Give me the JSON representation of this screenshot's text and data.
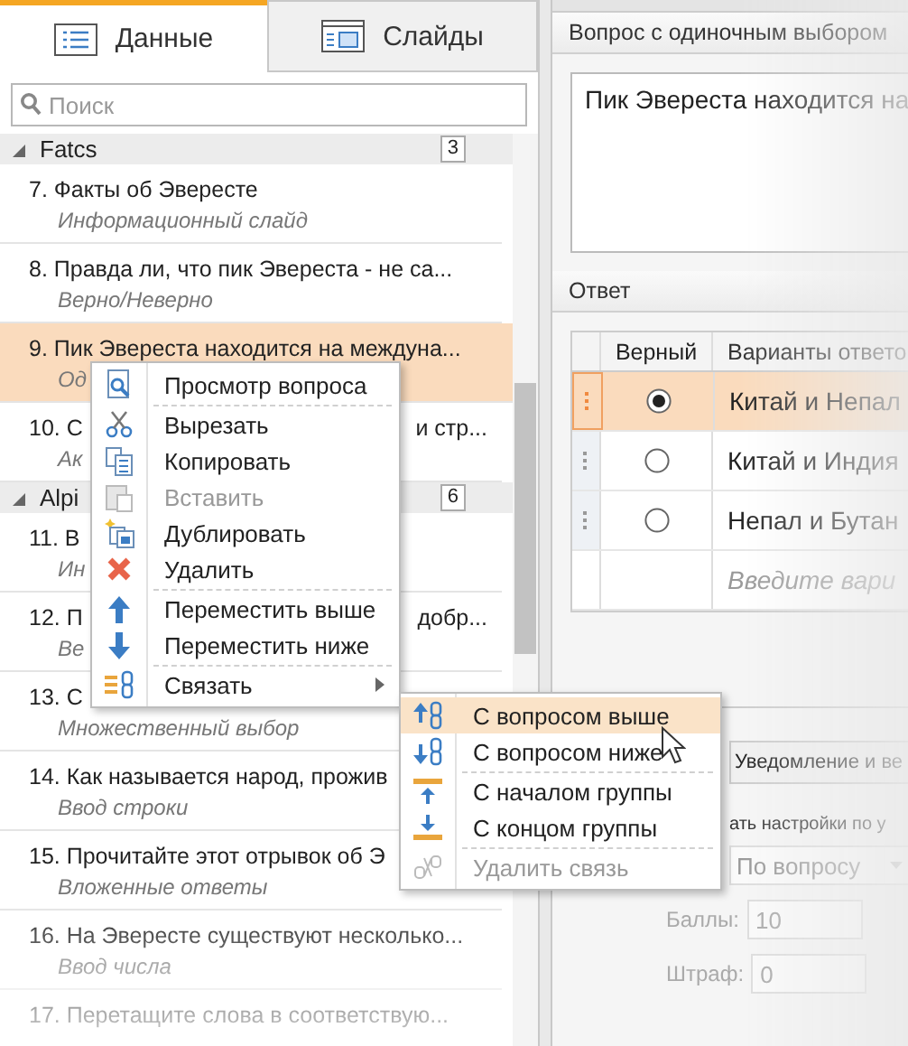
{
  "tabs": [
    {
      "label": "Данные",
      "selected": true
    },
    {
      "label": "Слайды",
      "selected": false
    }
  ],
  "search": {
    "placeholder": "Поиск"
  },
  "groups": [
    {
      "name": "Fatcs",
      "count": "3",
      "expanded": true,
      "items": [
        {
          "title": "7. Факты об Эвересте",
          "subtitle": "Информационный слайд",
          "selected": false
        },
        {
          "title": "8. Правда ли, что пик Эвереста - не са...",
          "subtitle": "Верно/Неверно",
          "selected": false
        },
        {
          "title": "9. Пик Эвереста находится на междуна...",
          "subtitle": "Од",
          "selected": true
        },
        {
          "title": "10. С",
          "title_end": "и стр...",
          "subtitle": "Ак",
          "selected": false
        }
      ]
    },
    {
      "name": "Alpi",
      "count": "6",
      "expanded": true,
      "items": [
        {
          "title": "11. В",
          "subtitle": "Ин",
          "selected": false
        },
        {
          "title": "12. П",
          "title_end": "добр...",
          "subtitle": "Ве",
          "selected": false
        },
        {
          "title": "13. С",
          "subtitle": "Множественный выбор",
          "selected": false
        },
        {
          "title": "14. Как называется народ, прожив",
          "subtitle": "Ввод строки",
          "selected": false
        },
        {
          "title": "15. Прочитайте этот отрывок об Э",
          "subtitle": "Вложенные ответы",
          "selected": false
        },
        {
          "title": "16. На Эвересте существуют несколько...",
          "subtitle": "Ввод числа",
          "selected": false
        },
        {
          "title": "17. Перетащите слова в соответствую...",
          "selected": false
        }
      ]
    }
  ],
  "context_menu": {
    "items": [
      {
        "kind": "item",
        "label": "Просмотр вопроса",
        "disabled": false
      },
      {
        "kind": "separator"
      },
      {
        "kind": "item",
        "label": "Вырезать",
        "disabled": false
      },
      {
        "kind": "item",
        "label": "Копировать",
        "disabled": false
      },
      {
        "kind": "item",
        "label": "Вставить",
        "disabled": true
      },
      {
        "kind": "item",
        "label": "Дублировать",
        "disabled": false
      },
      {
        "kind": "item",
        "label": "Удалить",
        "disabled": false
      },
      {
        "kind": "separator"
      },
      {
        "kind": "item",
        "label": "Переместить выше",
        "disabled": false
      },
      {
        "kind": "item",
        "label": "Переместить ниже",
        "disabled": false
      },
      {
        "kind": "separator"
      },
      {
        "kind": "item",
        "label": "Связать",
        "disabled": false,
        "has_submenu": true
      }
    ]
  },
  "submenu": {
    "items": [
      {
        "kind": "item",
        "label": "С вопросом выше",
        "selected": true,
        "disabled": false
      },
      {
        "kind": "item",
        "label": "С вопросом ниже",
        "selected": false,
        "disabled": false
      },
      {
        "kind": "separator"
      },
      {
        "kind": "item",
        "label": "С началом группы",
        "selected": false,
        "disabled": false
      },
      {
        "kind": "item",
        "label": "С концом группы",
        "selected": false,
        "disabled": false
      },
      {
        "kind": "separator"
      },
      {
        "kind": "item",
        "label": "Удалить связь",
        "selected": false,
        "disabled": true
      }
    ]
  },
  "question": {
    "header": "Вопрос с одиночным выбором",
    "text": "Пик Эвереста находится на"
  },
  "answer": {
    "header": "Ответ",
    "columns": [
      "Верный",
      "Варианты ответо"
    ],
    "rows": [
      {
        "text": "Китай и Непал",
        "correct": true,
        "selected": true
      },
      {
        "text": "Китай и Индия",
        "correct": false,
        "selected": false
      },
      {
        "text": "Непал и Бутан",
        "correct": false,
        "selected": false
      }
    ],
    "placeholder": "Введите вари"
  },
  "feedback": {
    "tab": "Уведомление и ве"
  },
  "settings": {
    "label": "ать настройки по у",
    "dropdown": "По вопросу",
    "fields": [
      {
        "label": "Баллы:",
        "value": "10",
        "disabled": true
      },
      {
        "label": "Штраф:",
        "value": "0",
        "disabled": true
      }
    ]
  }
}
